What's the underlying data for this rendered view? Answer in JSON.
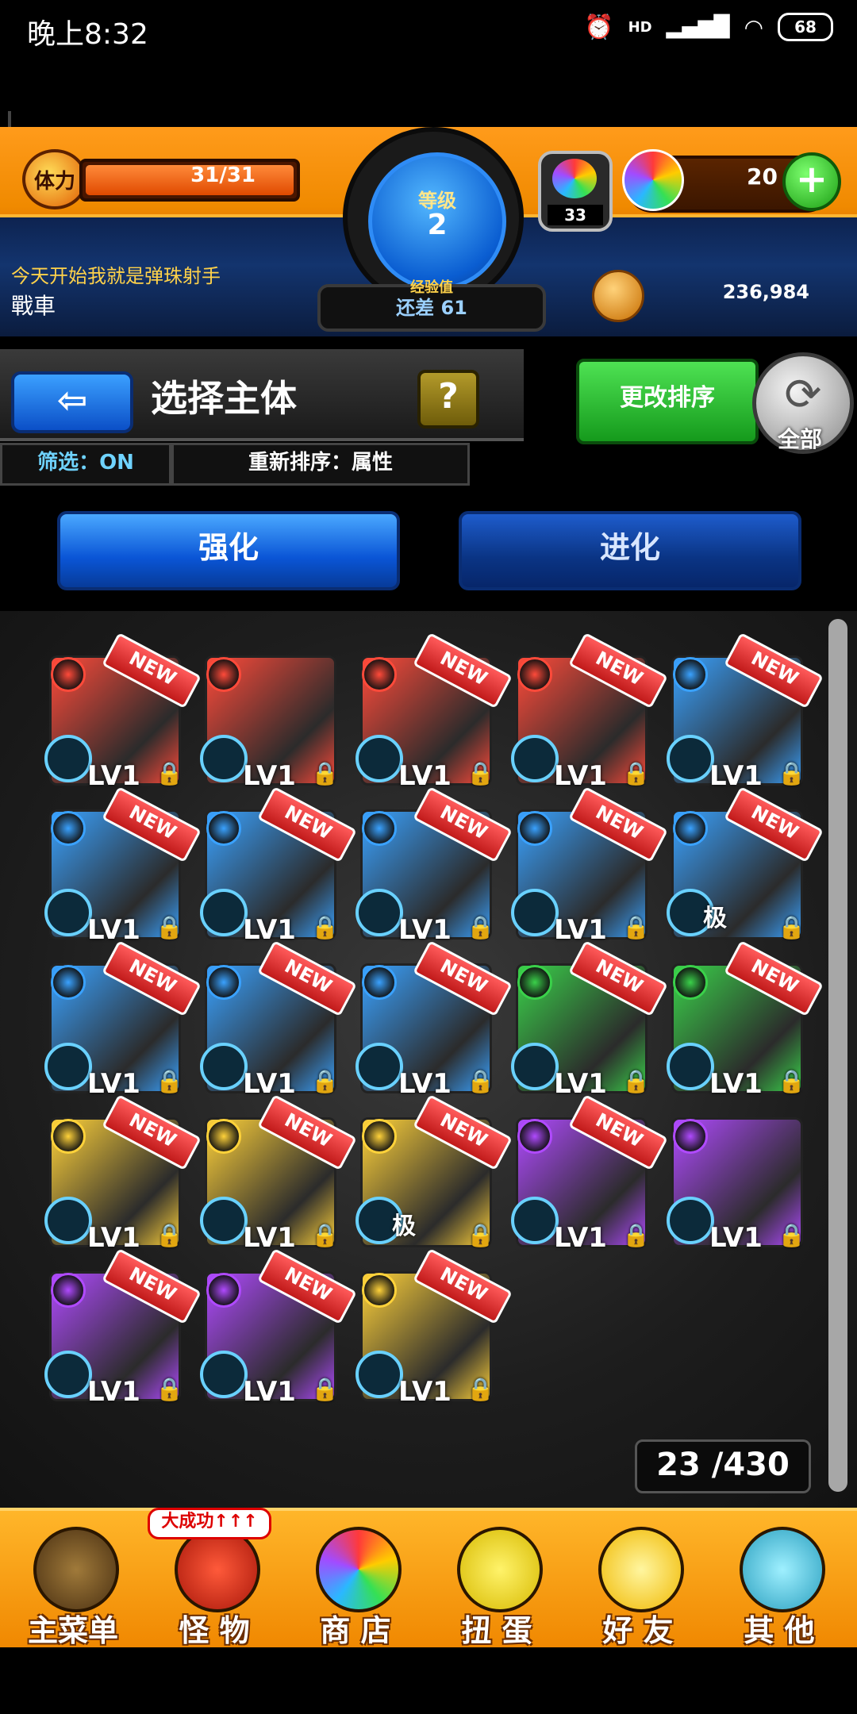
{
  "status_bar": {
    "time": "晚上8:32",
    "battery": "68",
    "network": "HD"
  },
  "header": {
    "stamina_icon_label": "体力",
    "stamina_value": "31/31",
    "level_label": "等级",
    "level": "2",
    "exp_label": "经验值",
    "exp_remaining": "还差 61",
    "small_orb_count": "33",
    "orb_count": "20",
    "coins": "236,984",
    "player_message": "今天开始我就是弹珠射手",
    "player_name": "戰車"
  },
  "title_bar": {
    "title": "选择主体",
    "help": "?",
    "filter": "筛选：ON",
    "sort": "重新排序：属性",
    "change_sort": "更改排序",
    "refresh_label": "全部"
  },
  "tabs": [
    {
      "label": "强化",
      "active": true
    },
    {
      "label": "进化",
      "active": false
    }
  ],
  "monsters": [
    {
      "attr": "fire",
      "new": true,
      "level": "LV1",
      "extra": ""
    },
    {
      "attr": "fire",
      "new": false,
      "level": "LV1",
      "extra": ""
    },
    {
      "attr": "fire",
      "new": true,
      "level": "LV1",
      "extra": ""
    },
    {
      "attr": "fire",
      "new": true,
      "level": "LV1",
      "extra": ""
    },
    {
      "attr": "water",
      "new": true,
      "level": "LV1",
      "extra": ""
    },
    {
      "attr": "water",
      "new": true,
      "level": "LV1",
      "extra": ""
    },
    {
      "attr": "water",
      "new": true,
      "level": "LV1",
      "extra": ""
    },
    {
      "attr": "water",
      "new": true,
      "level": "LV1",
      "extra": ""
    },
    {
      "attr": "water",
      "new": true,
      "level": "LV1",
      "extra": ""
    },
    {
      "attr": "water",
      "new": true,
      "level": "",
      "extra": "极"
    },
    {
      "attr": "water",
      "new": true,
      "level": "LV1",
      "extra": ""
    },
    {
      "attr": "water",
      "new": true,
      "level": "LV1",
      "extra": ""
    },
    {
      "attr": "water",
      "new": true,
      "level": "LV1",
      "extra": ""
    },
    {
      "attr": "wood",
      "new": true,
      "level": "LV1",
      "extra": ""
    },
    {
      "attr": "wood",
      "new": true,
      "level": "LV1",
      "extra": ""
    },
    {
      "attr": "light",
      "new": true,
      "level": "LV1",
      "extra": ""
    },
    {
      "attr": "light",
      "new": true,
      "level": "LV1",
      "extra": ""
    },
    {
      "attr": "light",
      "new": true,
      "level": "",
      "extra": "极"
    },
    {
      "attr": "dark",
      "new": true,
      "level": "LV1",
      "extra": ""
    },
    {
      "attr": "dark",
      "new": false,
      "level": "LV1",
      "extra": ""
    },
    {
      "attr": "dark",
      "new": true,
      "level": "LV1",
      "extra": ""
    },
    {
      "attr": "dark",
      "new": true,
      "level": "LV1",
      "extra": ""
    },
    {
      "attr": "light",
      "new": true,
      "level": "LV1",
      "extra": ""
    }
  ],
  "new_badge": "NEW",
  "box_count": "23 /430",
  "bottom_nav": [
    {
      "label": "主菜单",
      "icon": "gate-icon"
    },
    {
      "label": "怪 物",
      "icon": "monster-icon"
    },
    {
      "label": "商 店",
      "icon": "orb-shop-icon"
    },
    {
      "label": "扭 蛋",
      "icon": "egg-icon"
    },
    {
      "label": "好 友",
      "icon": "friends-icon"
    },
    {
      "label": "其 他",
      "icon": "other-icon"
    }
  ],
  "success_badge": "大成功↑↑↑",
  "colors": {
    "fire": "#ff4a3a",
    "water": "#3aa2ff",
    "wood": "#3ad14a",
    "light": "#ffd23a",
    "dark": "#b04aff"
  }
}
